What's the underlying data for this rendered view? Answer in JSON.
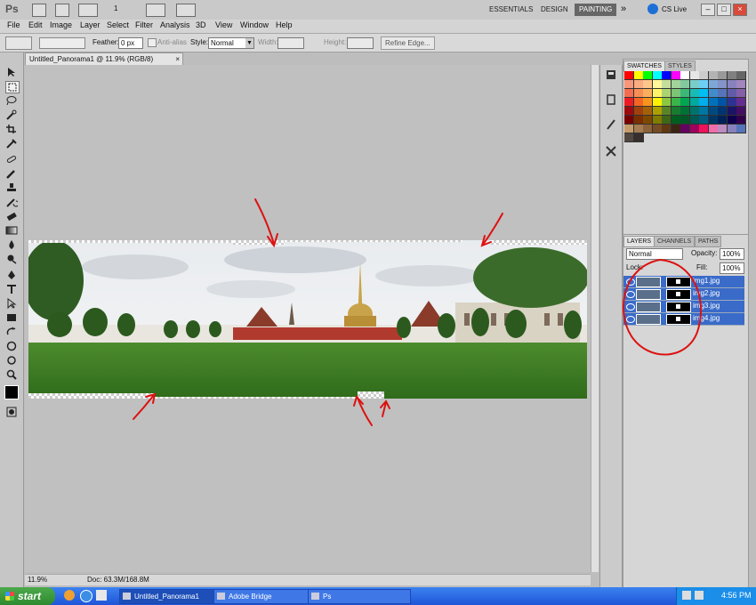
{
  "app": {
    "logo": "Ps",
    "zoom_label": "1",
    "workspaces": [
      "ESSENTIALS",
      "DESIGN",
      "PAINTING"
    ],
    "active_workspace": "PAINTING",
    "cs_live": "CS Live",
    "more": "»"
  },
  "menu": [
    "File",
    "Edit",
    "Image",
    "Layer",
    "Select",
    "Filter",
    "Analysis",
    "3D",
    "View",
    "Window",
    "Help"
  ],
  "options": {
    "feather_label": "Feather:",
    "feather_value": "0 px",
    "antialias_label": "Anti-alias",
    "style_label": "Style:",
    "style_value": "Normal",
    "width_label": "Width:",
    "height_label": "Height:",
    "refine_button": "Refine Edge..."
  },
  "document": {
    "tab_title": "Untitled_Panorama1 @ 11.9% (RGB/8)",
    "close": "×",
    "zoom": "11.9%",
    "doc_info": "Doc: 63.3M/168.8M"
  },
  "swatches_panel": {
    "tabs": [
      "SWATCHES",
      "STYLES"
    ],
    "colors": [
      "#ff0000",
      "#ffff00",
      "#00ff00",
      "#00ffff",
      "#0000ff",
      "#ff00ff",
      "#ffffff",
      "#e6e6e6",
      "#cccccc",
      "#b3b3b3",
      "#999999",
      "#808080",
      "#666666",
      "#f7977a",
      "#f9ad81",
      "#fdc68a",
      "#fff79a",
      "#c4df9b",
      "#a2d39c",
      "#82ca9d",
      "#7bcdc8",
      "#6ecff6",
      "#7ea7d8",
      "#8493ca",
      "#8882be",
      "#a187be",
      "#f26c4f",
      "#f68e55",
      "#fbaf5c",
      "#fff467",
      "#acd372",
      "#7cc576",
      "#3bb878",
      "#1abbb4",
      "#00bff3",
      "#438ccb",
      "#5574b9",
      "#605ca8",
      "#855fa8",
      "#ed1c24",
      "#f26522",
      "#f7941d",
      "#fff200",
      "#8dc73f",
      "#39b54a",
      "#00a651",
      "#00a99d",
      "#00aeef",
      "#0072bc",
      "#0054a6",
      "#2e3192",
      "#662d91",
      "#9e0b0f",
      "#a0410d",
      "#a3620a",
      "#aba000",
      "#598527",
      "#197b30",
      "#007236",
      "#00746b",
      "#0076a3",
      "#004a80",
      "#003471",
      "#1b1464",
      "#440e62",
      "#790000",
      "#7b2e00",
      "#7d4900",
      "#827b00",
      "#406618",
      "#005e20",
      "#005826",
      "#005952",
      "#005b7f",
      "#003663",
      "#002157",
      "#0d004c",
      "#32004b",
      "#c69c6d",
      "#a67c52",
      "#8c6239",
      "#754c24",
      "#603913",
      "#3c2415",
      "#630460",
      "#9e005d",
      "#ed145b",
      "#f06eaa",
      "#bd8cbf",
      "#8781bd",
      "#5574b9",
      "#534741",
      "#362f2d"
    ]
  },
  "layers_panel": {
    "tabs": [
      "LAYERS",
      "CHANNELS",
      "PATHS"
    ],
    "blend_mode": "Normal",
    "opacity_label": "Opacity:",
    "opacity_value": "100%",
    "lock_label": "Lock:",
    "fill_label": "Fill:",
    "fill_value": "100%",
    "layers": [
      {
        "name": "img1.jpg"
      },
      {
        "name": "img2.jpg"
      },
      {
        "name": "img3.jpg"
      },
      {
        "name": "img4.jpg"
      }
    ]
  },
  "taskbar": {
    "start": "start",
    "tasks": [
      "Untitled_Panorama1",
      "Adobe Bridge",
      "Ps"
    ],
    "clock": "4:56 PM"
  },
  "annotations": {
    "arrow_color": "#dd1111",
    "circle_color": "#dd1111"
  }
}
